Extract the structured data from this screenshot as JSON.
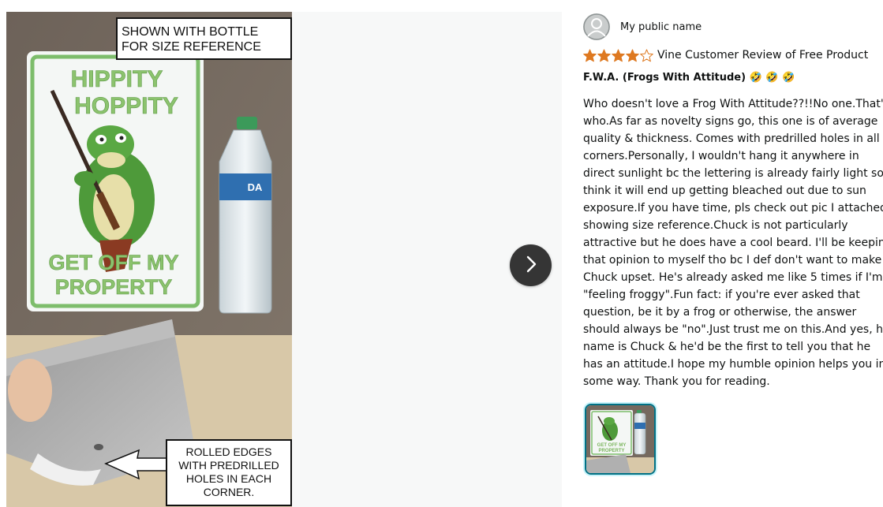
{
  "viewer": {
    "callout_top": [
      "SHOWN WITH BOTTLE",
      "FOR SIZE REFERENCE"
    ],
    "sign_text": [
      "HIPPITY",
      "HOPPITY",
      "GET OFF MY",
      "PROPERTY"
    ],
    "bottle_label": "DA",
    "callout_bottom": [
      "ROLLED EDGES",
      "WITH PREDRILLED",
      "HOLES IN EACH",
      "CORNER."
    ],
    "next_icon": "chevron-right-icon"
  },
  "review": {
    "reviewer_name": "My public name",
    "rating": 4,
    "max_rating": 5,
    "star_color": "#de7921",
    "vine_label": "Vine Customer Review of Free Product",
    "title": "F.W.A. (Frogs With Attitude) 🤣 🤣 🤣",
    "body": "Who doesn't love a Frog With Attitude??!!No one.That's who.As far as novelty signs go, this one is of average quality & thickness. Comes with predrilled holes in all 4 corners.Personally, I wouldn't hang it anywhere in direct sunlight bc the lettering is already fairly light so I think it will end up getting bleached out due to sun exposure.If you have time, pls check out pic I attached showing size reference.Chuck is not particularly attractive but he does have a cool beard. I'll be keeping that opinion to myself tho bc I def don't want to make Chuck upset. He's already asked me like 5 times if I'm \"feeling froggy\".Fun fact: if you're ever asked that question, be it by a frog or otherwise, the answer should always be \"no\".Just trust me on this.And yes, his name is Chuck & he'd be the first to tell you that he has an attitude.I hope my humble opinion helps you in some way. Thank you for reading.",
    "thumbnail_text": [
      "GET OFF MY",
      "PROPERTY"
    ],
    "accent_color": "#007185"
  }
}
